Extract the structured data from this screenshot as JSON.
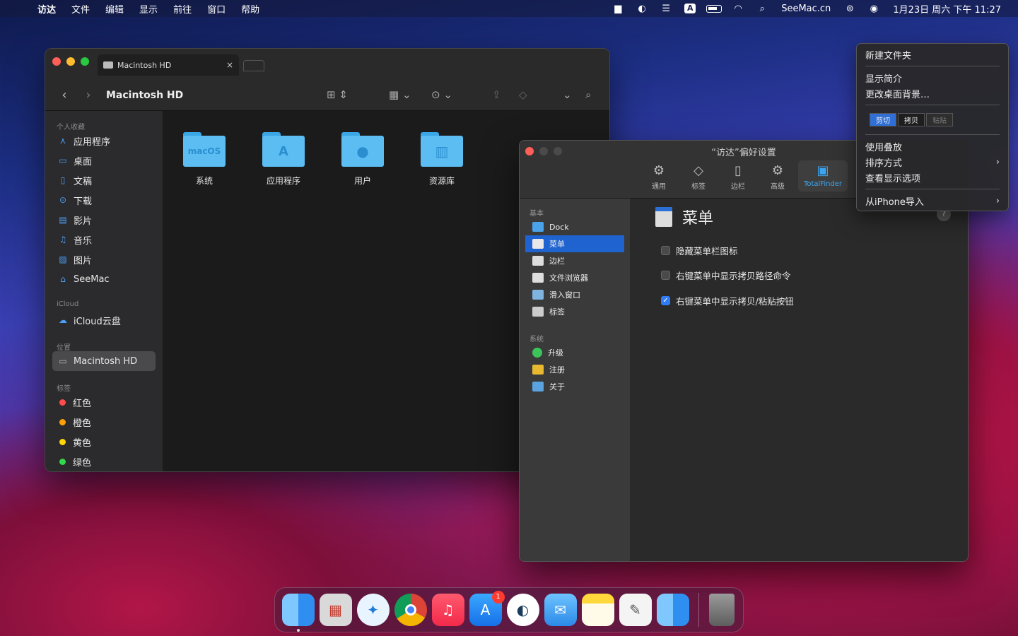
{
  "menubar": {
    "app_name": "访达",
    "items": [
      "文件",
      "编辑",
      "显示",
      "前往",
      "窗口",
      "帮助"
    ],
    "site": "SeeMac.cn",
    "clock": "1月23日 周六 下午 11:27",
    "input_method": "A"
  },
  "finder": {
    "tab_title": "Macintosh HD",
    "window_title": "Macintosh HD",
    "sidebar": {
      "favorites_header": "个人收藏",
      "favorites": [
        "应用程序",
        "桌面",
        "文稿",
        "下载",
        "影片",
        "音乐",
        "图片",
        "SeeMac"
      ],
      "icloud_header": "iCloud",
      "icloud": [
        "iCloud云盘"
      ],
      "locations_header": "位置",
      "locations": [
        "Macintosh HD"
      ],
      "tags_header": "标签",
      "tags": [
        {
          "label": "红色",
          "color": "#ff4d4d"
        },
        {
          "label": "橙色",
          "color": "#ff9f0a"
        },
        {
          "label": "黄色",
          "color": "#ffd60a"
        },
        {
          "label": "绿色",
          "color": "#32d74b"
        }
      ]
    },
    "folders": [
      {
        "label": "系统",
        "badge": "macOS"
      },
      {
        "label": "应用程序",
        "badge": "A"
      },
      {
        "label": "用户",
        "badge": "●"
      },
      {
        "label": "资源库",
        "badge": "▥"
      }
    ]
  },
  "prefs": {
    "title": "“访达”偏好设置",
    "tabs": [
      "通用",
      "标签",
      "边栏",
      "高级",
      "TotalFinder"
    ],
    "sidebar": {
      "basic_header": "基本",
      "basic": [
        "Dock",
        "菜单",
        "边栏",
        "文件浏览器",
        "滑入窗口",
        "标签"
      ],
      "system_header": "系统",
      "system": [
        "升级",
        "注册",
        "关于"
      ]
    },
    "section_title": "菜单",
    "options": [
      {
        "label": "隐藏菜单栏图标",
        "checked": false
      },
      {
        "label": "右键菜单中显示拷贝路径命令",
        "checked": false
      },
      {
        "label": "右键菜单中显示拷贝/粘贴按钮",
        "checked": true
      }
    ],
    "help": "?"
  },
  "context_menu": {
    "new_folder": "新建文件夹",
    "get_info": "显示简介",
    "change_bg": "更改桌面背景…",
    "cut": "剪切",
    "copy": "拷贝",
    "paste": "粘贴",
    "use_stacks": "使用叠放",
    "sort_by": "排序方式",
    "view_options": "查看显示选项",
    "import_iphone": "从iPhone导入"
  },
  "dock": {
    "appstore_badge": "1"
  }
}
